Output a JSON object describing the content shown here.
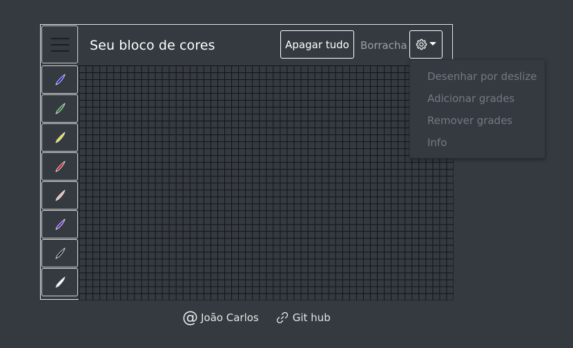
{
  "header": {
    "title": "Seu bloco de cores",
    "clear_label": "Apagar tudo",
    "eraser_label": "Borracha"
  },
  "palette": {
    "colors": [
      "#1515e0",
      "#0f7a1a",
      "#e8e21a",
      "#c01520",
      "#f0b8c0",
      "#5a1ad8",
      "#0a0a0a",
      "#ffffff"
    ]
  },
  "settings_menu": {
    "items": [
      "Desenhar por deslize",
      "Adicionar grades",
      "Remover grades",
      "Info"
    ]
  },
  "footer": {
    "author_symbol": "@",
    "author": "João Carlos",
    "github": "Git hub"
  }
}
